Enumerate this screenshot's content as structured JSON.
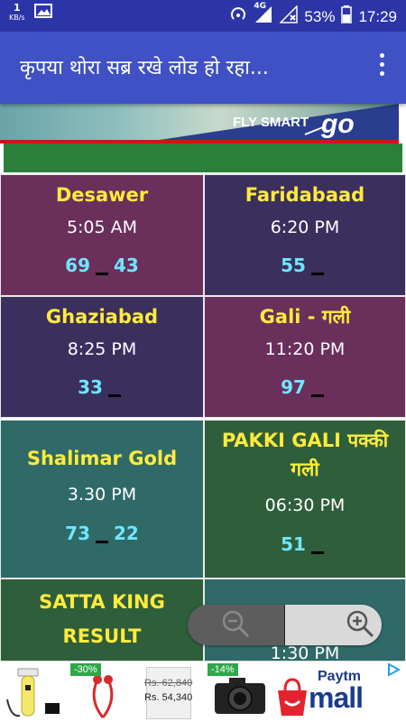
{
  "statusbar": {
    "speed_value": "1",
    "speed_unit": "KB/s",
    "network": "4G",
    "battery": "53%",
    "time": "17:29"
  },
  "appbar": {
    "title": "कृपया थोरा सब्र रखे  लोड हो रहा..."
  },
  "top_ad": {
    "tagline": "FLY SMART",
    "brand": "go"
  },
  "cards": [
    {
      "name": "Desawer",
      "time": "5:05 AM",
      "left": "69",
      "right": "43",
      "bg": "#6b2f5c"
    },
    {
      "name": "Faridabaad",
      "time": "6:20 PM",
      "left": "55",
      "right": "",
      "bg": "#3b2f5e"
    },
    {
      "name": "Ghaziabad",
      "time": "8:25 PM",
      "left": "33",
      "right": "",
      "bg": "#3b2f5e"
    },
    {
      "name": "Gali - गली",
      "time": "11:20 PM",
      "left": "97",
      "right": "",
      "bg": "#6b2f5c"
    },
    {
      "name": "Shalimar Gold",
      "time": "3.30 PM",
      "left": "73",
      "right": "22",
      "bg": "#2f6a68"
    },
    {
      "name": "PAKKI GALI पक्की गली",
      "time": "06:30 PM",
      "left": "51",
      "right": "",
      "bg": "#2f5e3a"
    },
    {
      "name": "SATTA KING RESULT",
      "time": "",
      "left": "",
      "right": "",
      "bg": "#2f5e3a"
    },
    {
      "name": "",
      "time": "1:30 PM",
      "left": "",
      "right": "",
      "bg": "#2f6a68"
    }
  ],
  "bottom_ad": {
    "product1": "",
    "product2_badge": "-30%",
    "product3_old_price": "Rs. 62,840",
    "product3_new_price": "Rs. 54,340",
    "product4_badge": "-14%",
    "paytm_line1": "Paytm",
    "paytm_line2": "mall"
  },
  "colors": {
    "statusbar": "#2c35a8",
    "appbar": "#3f51c4",
    "name_text": "#ffeb3b",
    "number_text": "#6fe6ff"
  }
}
